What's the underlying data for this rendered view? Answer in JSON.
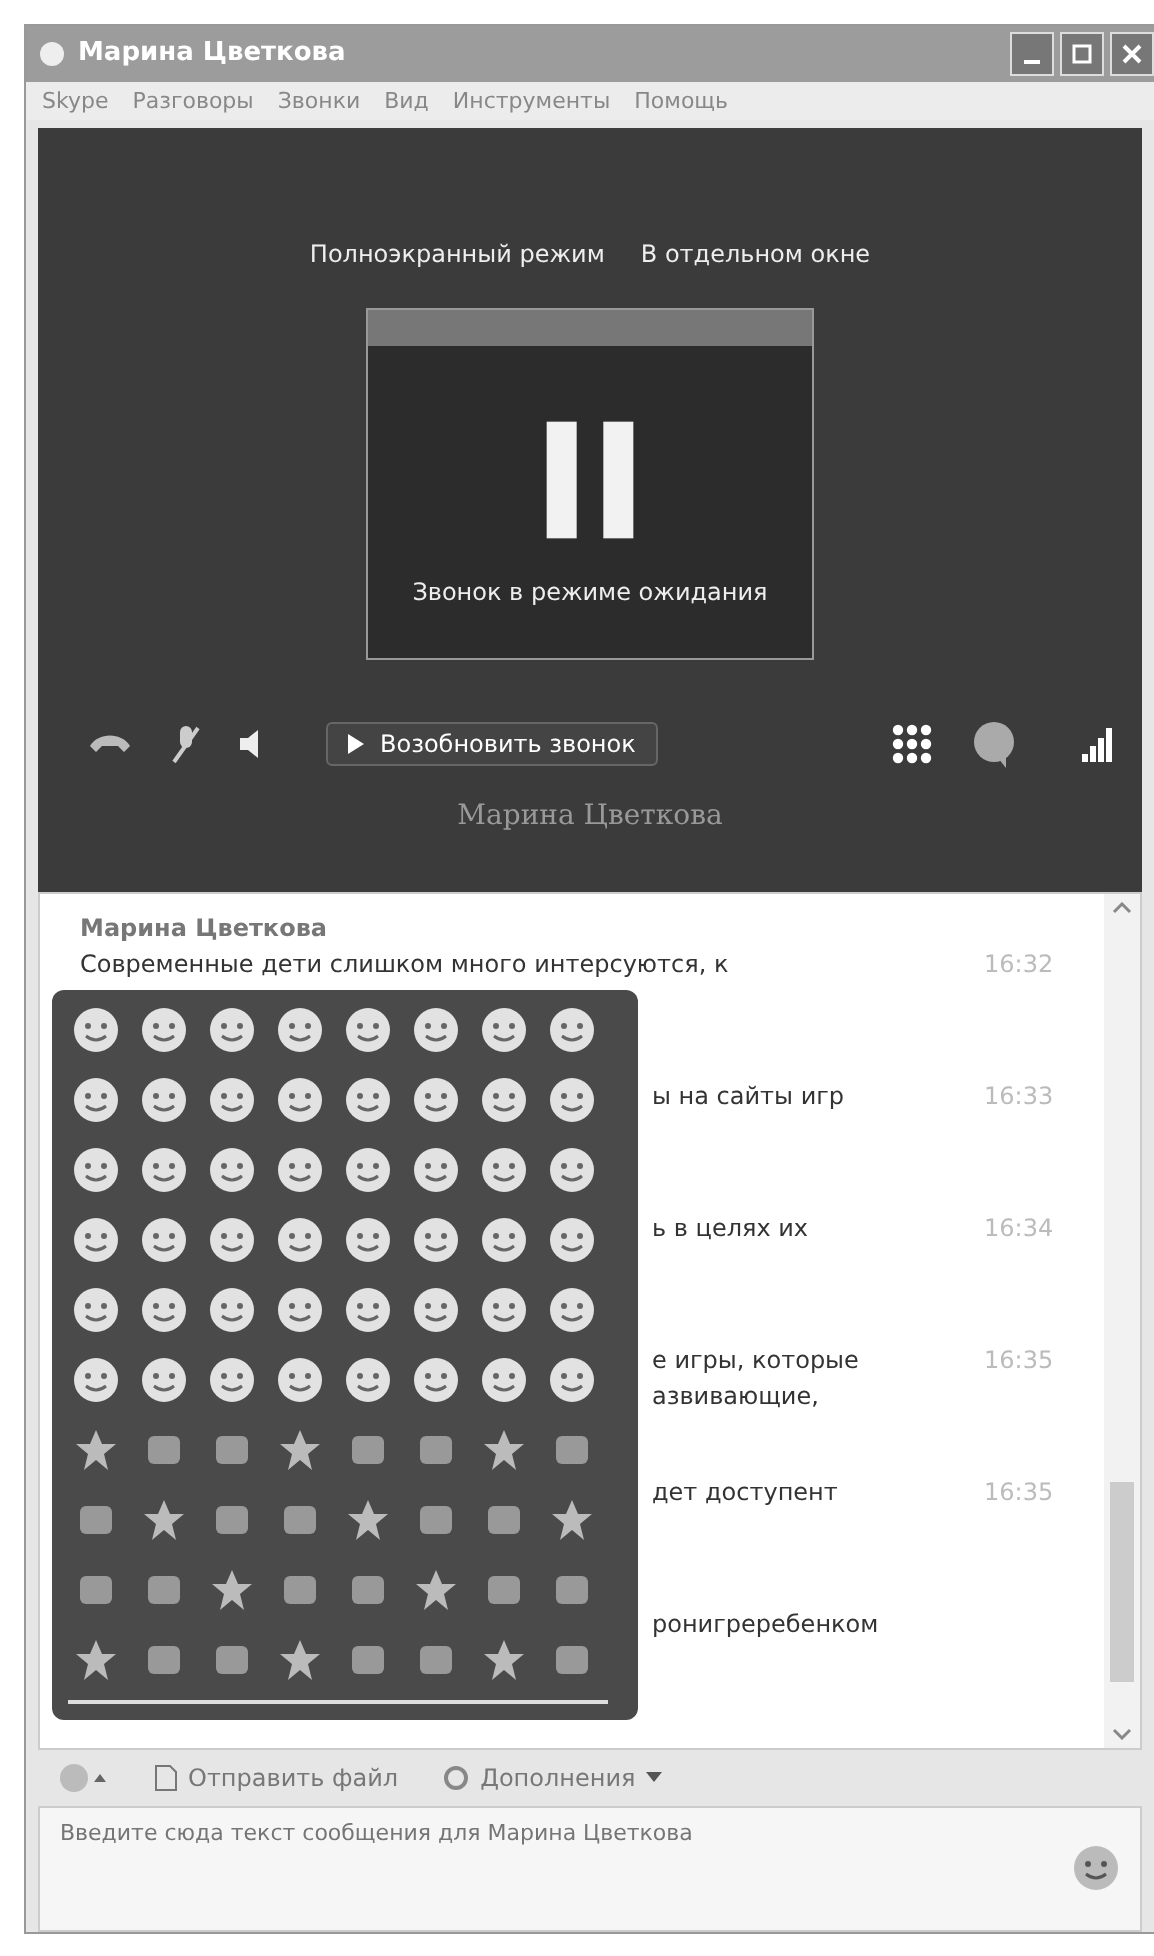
{
  "window": {
    "title": "Марина Цветкова"
  },
  "menu": [
    "Skype",
    "Разговоры",
    "Звонки",
    "Вид",
    "Инструменты",
    "Помощь"
  ],
  "call": {
    "links": [
      "Полноэкранный режим",
      "В отдельном окне"
    ],
    "status": "Звонок в режиме ожидания",
    "resume_button": "Возобновить звонок",
    "contact": "Марина Цветкова"
  },
  "chat": {
    "sender": "Марина Цветкова",
    "messages": [
      {
        "lines": [
          "Современные дети слишком много интерсуются, к"
        ],
        "time": "16:32",
        "covered": false
      },
      {
        "lines": [
          "ы на сайты игр"
        ],
        "time": "16:33",
        "covered": true
      },
      {
        "lines": [
          "ь в целях их"
        ],
        "time": "16:34",
        "covered": true
      },
      {
        "lines": [
          "е игры, которые",
          "азвивающие,"
        ],
        "time": "16:35",
        "covered": true
      },
      {
        "lines": [
          "дет доступент"
        ],
        "time": "16:35",
        "covered": true
      },
      {
        "lines": [
          "ронигреребенком"
        ],
        "covered": true
      }
    ]
  },
  "toolbar": {
    "send_file": "Отправить файл",
    "extras": "Дополнения"
  },
  "input": {
    "placeholder": "Введите сюда текст сообщения для Марина Цветкова"
  }
}
